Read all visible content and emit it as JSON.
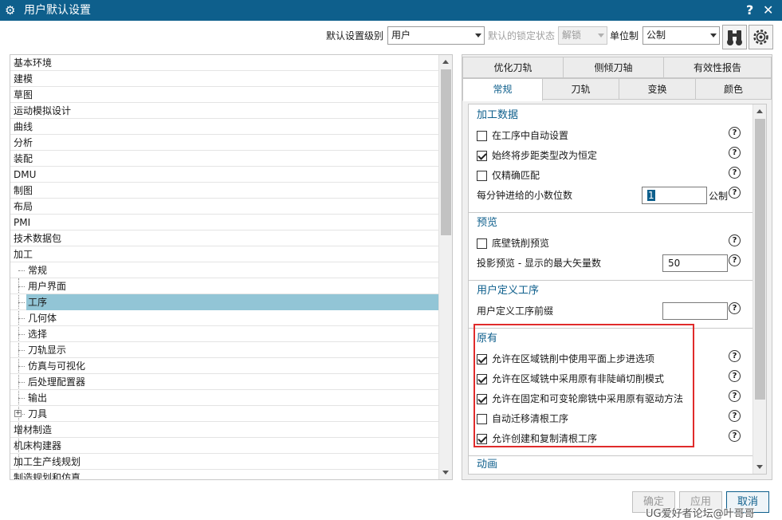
{
  "window": {
    "title": "用户默认设置",
    "help": "?",
    "close": "✕"
  },
  "toolbar": {
    "level_label": "默认设置级别",
    "level_value": "用户",
    "lock_label": "默认的锁定状态",
    "lock_value": "解锁",
    "unit_label": "单位制",
    "unit_value": "公制"
  },
  "tree": [
    {
      "label": "基本环境",
      "level": 1
    },
    {
      "label": "建模",
      "level": 1
    },
    {
      "label": "草图",
      "level": 1
    },
    {
      "label": "运动模拟设计",
      "level": 1
    },
    {
      "label": "曲线",
      "level": 1
    },
    {
      "label": "分析",
      "level": 1
    },
    {
      "label": "装配",
      "level": 1
    },
    {
      "label": "DMU",
      "level": 1
    },
    {
      "label": "制图",
      "level": 1
    },
    {
      "label": "布局",
      "level": 1
    },
    {
      "label": "PMI",
      "level": 1
    },
    {
      "label": "技术数据包",
      "level": 1
    },
    {
      "label": "加工",
      "level": 1
    },
    {
      "label": "常规",
      "level": 2
    },
    {
      "label": "用户界面",
      "level": 2
    },
    {
      "label": "工序",
      "level": 2,
      "selected": true
    },
    {
      "label": "几何体",
      "level": 2
    },
    {
      "label": "选择",
      "level": 2
    },
    {
      "label": "刀轨显示",
      "level": 2
    },
    {
      "label": "仿真与可视化",
      "level": 2
    },
    {
      "label": "后处理配置器",
      "level": 2
    },
    {
      "label": "输出",
      "level": 2
    },
    {
      "label": "刀具",
      "level": 2,
      "expandable": true
    },
    {
      "label": "增材制造",
      "level": 1
    },
    {
      "label": "机床构建器",
      "level": 1
    },
    {
      "label": "加工生产线规划",
      "level": 1
    },
    {
      "label": "制造规划和仿真",
      "level": 1
    }
  ],
  "tabs_row1": [
    "优化刀轨",
    "侧倾刀轴",
    "有效性报告"
  ],
  "tabs_row2": [
    "常规",
    "刀轨",
    "变换",
    "颜色"
  ],
  "sections": {
    "machining_data": {
      "title": "加工数据",
      "auto_set": {
        "label": "在工序中自动设置",
        "checked": false
      },
      "stepover_const": {
        "label": "始终将步距类型改为恒定",
        "checked": true
      },
      "exact_match": {
        "label": "仅精确匹配",
        "checked": false
      },
      "decimals_label": "每分钟进给的小数位数",
      "decimals_value": "1",
      "decimals_unit": "公制"
    },
    "preview": {
      "title": "预览",
      "floor_wall": {
        "label": "底壁铣削预览",
        "checked": false
      },
      "max_vectors_label": "投影预览 - 显示的最大矢量数",
      "max_vectors_value": "50"
    },
    "user_op": {
      "title": "用户定义工序",
      "prefix_label": "用户定义工序前缀",
      "prefix_value": ""
    },
    "legacy": {
      "title": "原有",
      "opt1": {
        "label": "允许在区域铣削中使用平面上步进选项",
        "checked": true
      },
      "opt2": {
        "label": "允许在区域铣中采用原有非陡峭切削模式",
        "checked": true
      },
      "opt3": {
        "label": "允许在固定和可变轮廓铣中采用原有驱动方法",
        "checked": true
      },
      "opt4": {
        "label": "自动迁移清根工序",
        "checked": false
      },
      "opt5": {
        "label": "允许创建和复制清根工序",
        "checked": true
      }
    },
    "animation": {
      "title": "动画"
    }
  },
  "help_glyph": "?",
  "buttons": {
    "ok": "确定",
    "apply": "应用",
    "cancel": "取消"
  },
  "watermark": "UG爱好者论坛@叶哥哥",
  "colors": {
    "title_bar": "#0e5f8c",
    "selection": "#92c5d6",
    "highlight_box": "#e02b2b"
  }
}
